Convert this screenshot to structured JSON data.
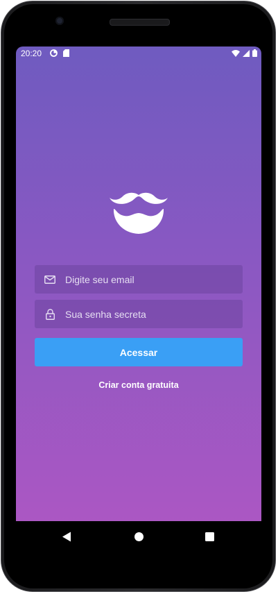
{
  "status_bar": {
    "time": "20:20",
    "left_icons": [
      "data-saver-icon",
      "sd-card-icon"
    ],
    "right_icons": [
      "wifi-icon",
      "cell-signal-icon",
      "battery-icon"
    ]
  },
  "app": {
    "logo_icon": "mustache-beard-logo-icon",
    "email_field": {
      "icon": "mail-icon",
      "placeholder": "Digite seu email",
      "value": ""
    },
    "password_field": {
      "icon": "lock-icon",
      "placeholder": "Sua senha secreta",
      "value": ""
    },
    "login_button_label": "Acessar",
    "create_account_label": "Criar conta gratuita"
  },
  "navigation_bar": {
    "buttons": [
      "back-icon",
      "home-icon",
      "recents-icon"
    ]
  },
  "colors": {
    "gradient_top": "#6f5bc0",
    "gradient_bottom": "#ab57c3",
    "primary_button": "#3a9ff5",
    "input_background": "#6e46a0"
  }
}
